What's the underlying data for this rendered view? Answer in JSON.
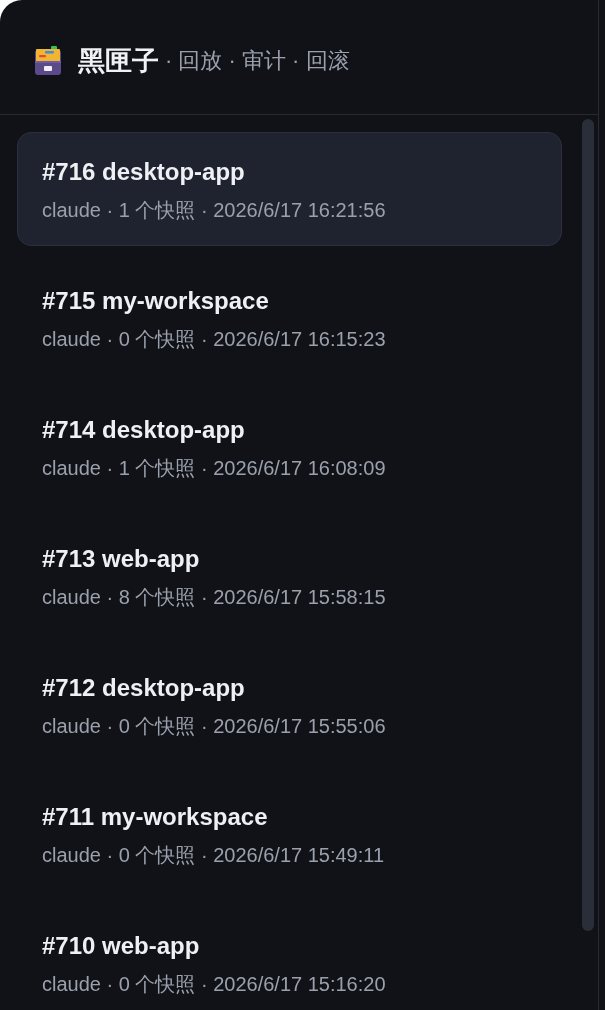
{
  "header": {
    "title": "黑匣子",
    "subtitle": "· 回放 · 审计 · 回滚"
  },
  "sessions": [
    {
      "title": "#716 desktop-app",
      "meta": "claude · 1 个快照 · 2026/6/17 16:21:56",
      "selected": true
    },
    {
      "title": "#715 my-workspace",
      "meta": "claude · 0 个快照 · 2026/6/17 16:15:23",
      "selected": false
    },
    {
      "title": "#714 desktop-app",
      "meta": "claude · 1 个快照 · 2026/6/17 16:08:09",
      "selected": false
    },
    {
      "title": "#713 web-app",
      "meta": "claude · 8 个快照 · 2026/6/17 15:58:15",
      "selected": false
    },
    {
      "title": "#712 desktop-app",
      "meta": "claude · 0 个快照 · 2026/6/17 15:55:06",
      "selected": false
    },
    {
      "title": "#711 my-workspace",
      "meta": "claude · 0 个快照 · 2026/6/17 15:49:11",
      "selected": false
    },
    {
      "title": "#710 web-app",
      "meta": "claude · 0 个快照 · 2026/6/17 15:16:20",
      "selected": false
    }
  ]
}
